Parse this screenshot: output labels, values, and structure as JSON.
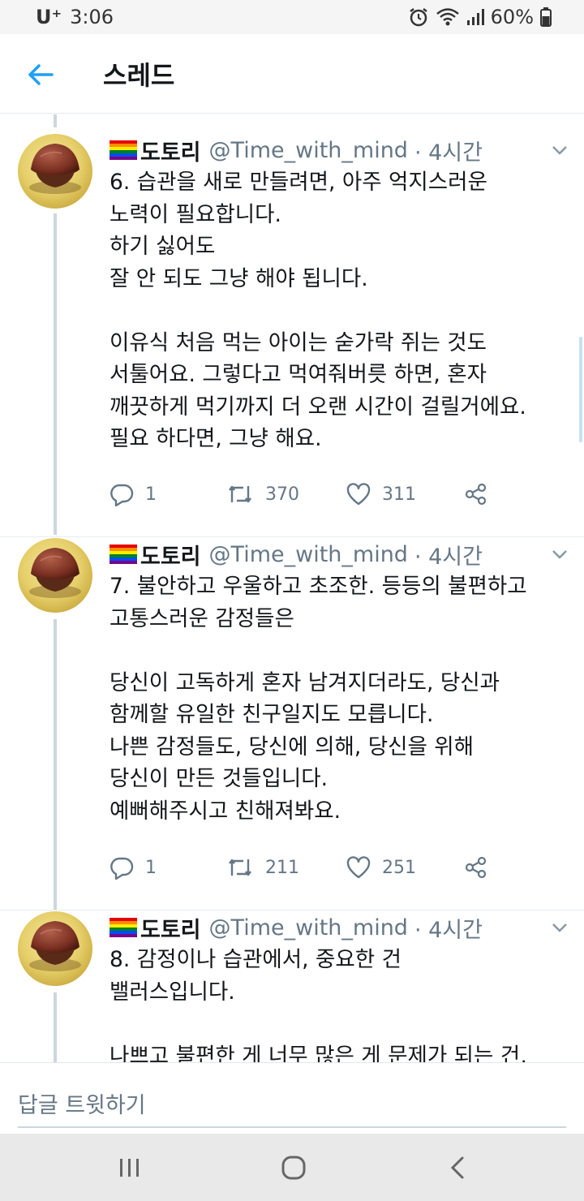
{
  "status_bar": {
    "carrier": "U⁺",
    "time": "3:06",
    "battery": "60%",
    "icons": [
      "alarm-icon",
      "wifi-icon",
      "signal-icon",
      "battery-icon"
    ]
  },
  "header": {
    "back_icon": "back-arrow-icon",
    "title": "스레드"
  },
  "tweets": [
    {
      "name": "도토리",
      "handle": "@Time_with_mind",
      "time": "· 4시간",
      "lines": [
        "6. 습관을 새로 만들려면, 아주 억지스러운",
        "노력이 필요합니다.",
        "하기 싫어도",
        "잘 안 되도 그냥 해야 됩니다.",
        "",
        "이유식 처음 먹는 아이는 숟가락 쥐는 것도",
        "서툴어요. 그렇다고 먹여줘버릇 하면, 혼자",
        "깨끗하게 먹기까지 더 오랜 시간이 걸릴거에요.",
        "필요 하다면, 그냥 해요."
      ],
      "replies": "1",
      "retweets": "370",
      "likes": "311"
    },
    {
      "name": "도토리",
      "handle": "@Time_with_mind",
      "time": "· 4시간",
      "lines": [
        "7. 불안하고 우울하고 초조한. 등등의 불편하고",
        "고통스러운 감정들은",
        "",
        "당신이 고독하게 혼자 남겨지더라도, 당신과",
        "함께할 유일한 친구일지도 모릅니다.",
        "나쁜 감정들도, 당신에 의해, 당신을 위해",
        "당신이 만든 것들입니다.",
        "예뻐해주시고 친해져봐요."
      ],
      "replies": "1",
      "retweets": "211",
      "likes": "251"
    },
    {
      "name": "도토리",
      "handle": "@Time_with_mind",
      "time": "· 4시간",
      "lines": [
        "8. 감정이나 습관에서, 중요한 건",
        "밸러스입니다.",
        "",
        "나쁘고 불편한 게 너무 많은 게 문제가 되는 건,"
      ]
    }
  ],
  "reply_bar": {
    "placeholder": "답글 트윗하기"
  },
  "nav_bar": {
    "icons": [
      "recent-apps-icon",
      "home-icon",
      "back-icon"
    ]
  },
  "colors": {
    "accent": "#1da1f2",
    "secondary_text": "#657786",
    "divider": "#e6ecf0"
  }
}
